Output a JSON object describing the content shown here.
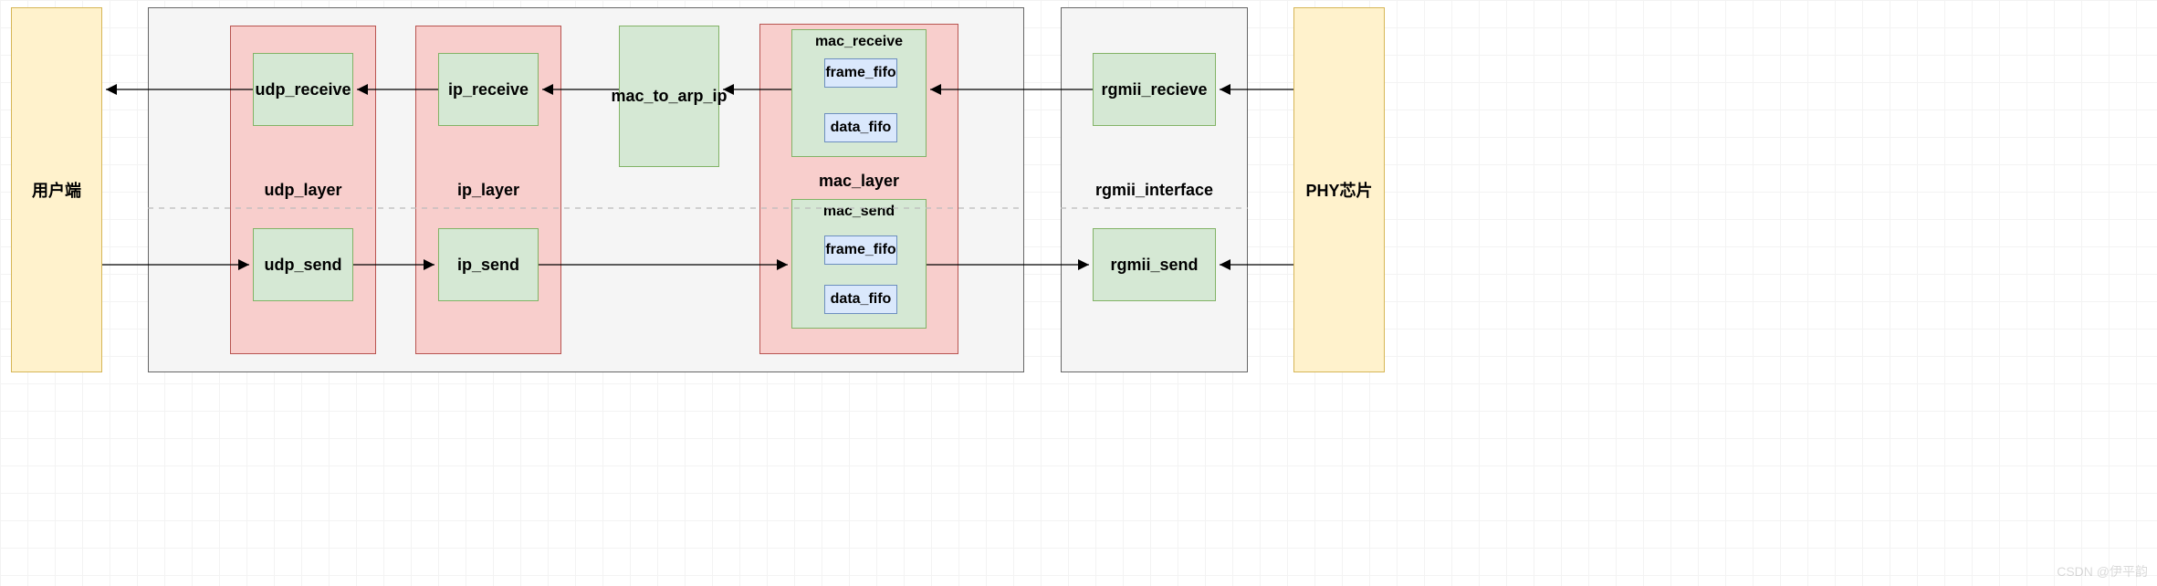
{
  "endpoints": {
    "user": "用户端",
    "phy": "PHY芯片"
  },
  "main_container": {
    "udp_layer": {
      "label": "udp_layer",
      "receive": "udp_receive",
      "send": "udp_send"
    },
    "ip_layer": {
      "label": "ip_layer",
      "receive": "ip_receive",
      "send": "ip_send"
    },
    "mac_to_arp_ip": "mac_to_arp_ip",
    "mac_layer": {
      "label": "mac_layer",
      "receive": {
        "label": "mac_receive",
        "fifo1": "frame_fifo",
        "fifo2": "data_fifo"
      },
      "send": {
        "label": "mac_send",
        "fifo1": "frame_fifo",
        "fifo2": "data_fifo"
      }
    }
  },
  "rgmii_interface": {
    "label": "rgmii_interface",
    "receive": "rgmii_recieve",
    "send": "rgmii_send"
  },
  "watermark": "CSDN @伊平韵",
  "colors": {
    "yellow_fill": "#fff2cc",
    "yellow_border": "#d6b656",
    "grey_fill": "#f5f5f5",
    "grey_border": "#666666",
    "pink_fill": "#f8cecc",
    "pink_border": "#b85450",
    "green_fill": "#d5e8d4",
    "green_border": "#82b366",
    "blue_fill": "#dae8fc",
    "blue_border": "#6c8ebf",
    "arrow": "#000000"
  },
  "chart_data": {
    "type": "diagram",
    "title": "Network stack block diagram",
    "nodes": [
      {
        "id": "user",
        "label": "用户端",
        "kind": "endpoint"
      },
      {
        "id": "phy",
        "label": "PHY芯片",
        "kind": "endpoint"
      },
      {
        "id": "main",
        "label": "",
        "kind": "container"
      },
      {
        "id": "udp_layer",
        "label": "udp_layer",
        "parent": "main",
        "kind": "layer"
      },
      {
        "id": "udp_receive",
        "label": "udp_receive",
        "parent": "udp_layer",
        "kind": "module"
      },
      {
        "id": "udp_send",
        "label": "udp_send",
        "parent": "udp_layer",
        "kind": "module"
      },
      {
        "id": "ip_layer",
        "label": "ip_layer",
        "parent": "main",
        "kind": "layer"
      },
      {
        "id": "ip_receive",
        "label": "ip_receive",
        "parent": "ip_layer",
        "kind": "module"
      },
      {
        "id": "ip_send",
        "label": "ip_send",
        "parent": "ip_layer",
        "kind": "module"
      },
      {
        "id": "mac_to_arp_ip",
        "label": "mac_to_arp_ip",
        "parent": "main",
        "kind": "module"
      },
      {
        "id": "mac_layer",
        "label": "mac_layer",
        "parent": "main",
        "kind": "layer"
      },
      {
        "id": "mac_receive",
        "label": "mac_receive",
        "parent": "mac_layer",
        "kind": "module"
      },
      {
        "id": "mac_receive_frame_fifo",
        "label": "frame_fifo",
        "parent": "mac_receive",
        "kind": "fifo"
      },
      {
        "id": "mac_receive_data_fifo",
        "label": "data_fifo",
        "parent": "mac_receive",
        "kind": "fifo"
      },
      {
        "id": "mac_send",
        "label": "mac_send",
        "parent": "mac_layer",
        "kind": "module"
      },
      {
        "id": "mac_send_frame_fifo",
        "label": "frame_fifo",
        "parent": "mac_send",
        "kind": "fifo"
      },
      {
        "id": "mac_send_data_fifo",
        "label": "data_fifo",
        "parent": "mac_send",
        "kind": "fifo"
      },
      {
        "id": "rgmii_interface",
        "label": "rgmii_interface",
        "kind": "container"
      },
      {
        "id": "rgmii_receive",
        "label": "rgmii_recieve",
        "parent": "rgmii_interface",
        "kind": "module"
      },
      {
        "id": "rgmii_send",
        "label": "rgmii_send",
        "parent": "rgmii_interface",
        "kind": "module"
      }
    ],
    "edges_receive_path": [
      {
        "from": "phy",
        "to": "rgmii_receive"
      },
      {
        "from": "rgmii_receive",
        "to": "mac_receive"
      },
      {
        "from": "mac_receive",
        "to": "mac_to_arp_ip"
      },
      {
        "from": "mac_to_arp_ip",
        "to": "ip_receive"
      },
      {
        "from": "ip_receive",
        "to": "udp_receive"
      },
      {
        "from": "udp_receive",
        "to": "user"
      }
    ],
    "edges_send_path": [
      {
        "from": "user",
        "to": "udp_send"
      },
      {
        "from": "udp_send",
        "to": "ip_send"
      },
      {
        "from": "ip_send",
        "to": "mac_send"
      },
      {
        "from": "mac_send",
        "to": "rgmii_send"
      },
      {
        "from": "phy",
        "to": "rgmii_send"
      }
    ]
  }
}
